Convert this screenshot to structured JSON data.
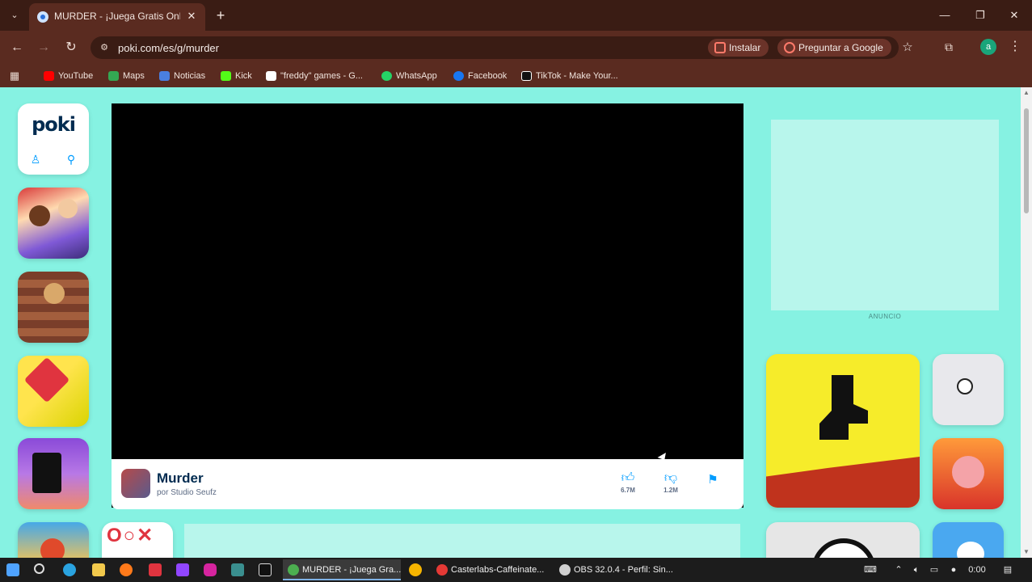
{
  "browser": {
    "tab_title": "MURDER - ¡Juega Gratis Online",
    "tab_close": "✕",
    "new_tab": "+",
    "window_controls": {
      "minimize": "—",
      "maximize": "❐",
      "close": "✕"
    },
    "nav": {
      "back": "←",
      "forward": "→",
      "reload": "↻"
    },
    "url": "poki.com/es/g/murder",
    "install_label": "Instalar",
    "ask_google_label": "Preguntar a Google",
    "bookmark_star": "☆",
    "profile_letter": "a",
    "bookmarks": [
      {
        "label": "YouTube",
        "icon": "youtube-icon",
        "color": "#ff0000"
      },
      {
        "label": "Maps",
        "icon": "maps-icon",
        "color": "#34a853"
      },
      {
        "label": "Noticias",
        "icon": "news-icon",
        "color": "#4a7fe0"
      },
      {
        "label": "Kick",
        "icon": "kick-icon",
        "color": "#53fc18"
      },
      {
        "label": "\"freddy\" games - G...",
        "icon": "lightning-icon",
        "color": "#ffffff"
      },
      {
        "label": "WhatsApp",
        "icon": "whatsapp-icon",
        "color": "#25d366"
      },
      {
        "label": "Facebook",
        "icon": "facebook-icon",
        "color": "#1877f2"
      },
      {
        "label": "TikTok - Make Your...",
        "icon": "tiktok-icon",
        "color": "#111111"
      }
    ]
  },
  "page": {
    "logo": "poki",
    "game": {
      "name": "Murder",
      "author": "por Studio Seufz",
      "likes": "6.7M",
      "dislikes": "1.2M"
    },
    "ad_label": "ANUNCIO"
  },
  "taskbar": {
    "apps": [
      {
        "label": "MURDER - ¡Juega Gra...",
        "color": "#4caf50",
        "active": true
      },
      {
        "label": "Casterlabs-Caffeinate...",
        "color": "#e53935",
        "active": false
      },
      {
        "label": "OBS 32.0.4 - Perfil: Sin...",
        "color": "#d0d0d0",
        "active": false
      }
    ],
    "time": "0:00"
  }
}
